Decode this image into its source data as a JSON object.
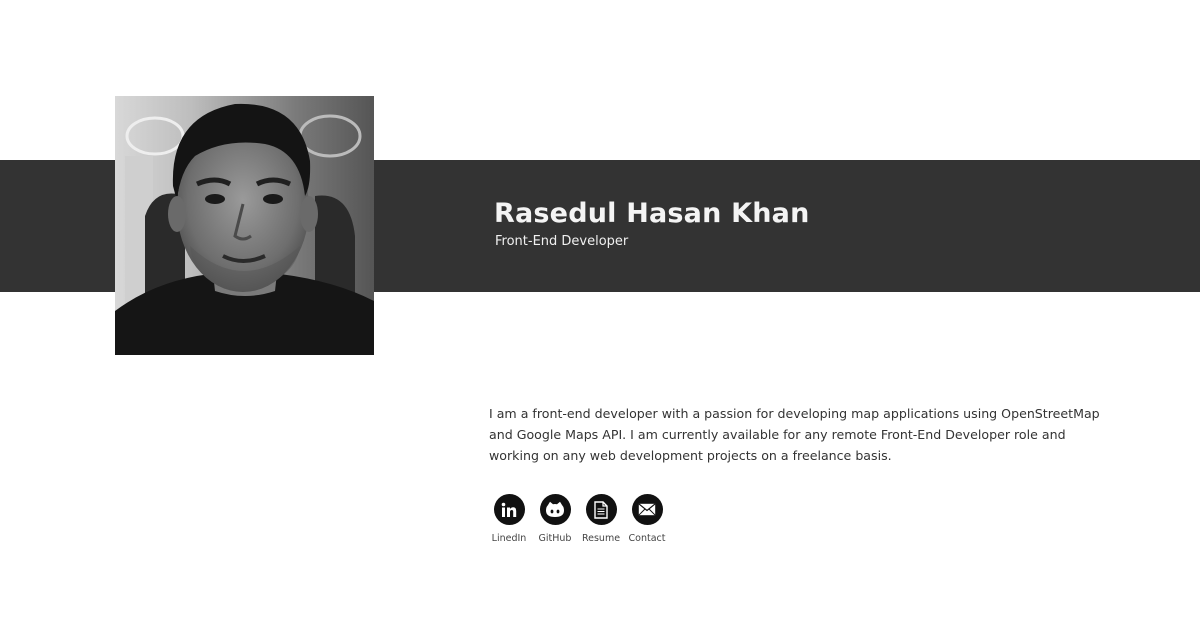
{
  "profile": {
    "name": "Rasedul Hasan Khan",
    "role": "Front-End Developer",
    "photo_icon": "profile-photo",
    "bio": "I am a front-end developer with a passion for developing map applications using OpenStreetMap and Google Maps API. I am currently available for any remote Front-End Developer role and working on any web development projects on a freelance basis."
  },
  "links": [
    {
      "label": "LinedIn",
      "icon": "linkedin-icon"
    },
    {
      "label": "GitHub",
      "icon": "github-icon"
    },
    {
      "label": "Resume",
      "icon": "document-icon"
    },
    {
      "label": "Contact",
      "icon": "mail-icon"
    }
  ],
  "colors": {
    "banner": "#333333",
    "background": "#ffffff",
    "icon_circle": "#111111"
  }
}
